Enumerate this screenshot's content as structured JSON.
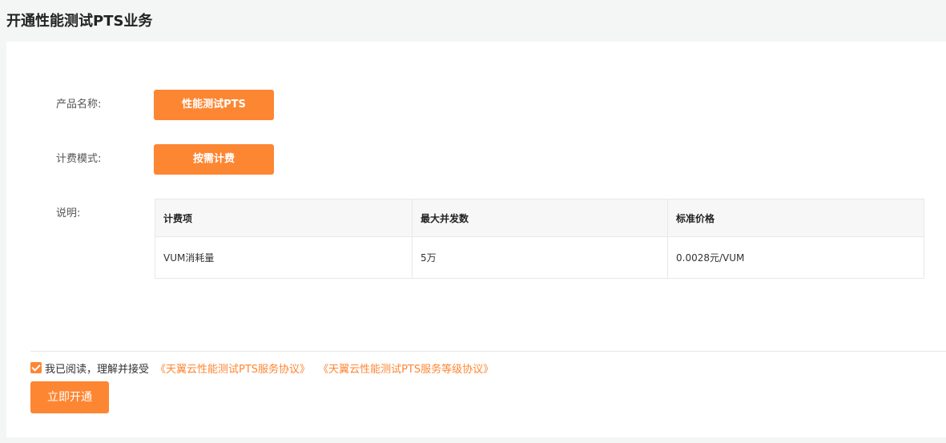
{
  "page": {
    "title": "开通性能测试PTS业务"
  },
  "form": {
    "product_label": "产品名称:",
    "product_value": "性能测试PTS",
    "billing_label": "计费模式:",
    "billing_value": "按需计费",
    "description_label": "说明:"
  },
  "pricing_table": {
    "headers": [
      "计费项",
      "最大并发数",
      "标准价格"
    ],
    "rows": [
      [
        "VUM消耗量",
        "5万",
        "0.0028元/VUM"
      ]
    ]
  },
  "agreement": {
    "checked": true,
    "text": "我已阅读，理解并接受",
    "link_service": "《天翼云性能测试PTS服务协议》",
    "link_sla": "《天翼云性能测试PTS服务等级协议》"
  },
  "actions": {
    "submit_label": "立即开通"
  },
  "colors": {
    "accent": "#fd8633",
    "page_background": "#f4f5f5",
    "panel_background": "#ffffff",
    "table_header_background": "#f7f7f7"
  },
  "icons": {
    "checkbox": "check-icon"
  }
}
